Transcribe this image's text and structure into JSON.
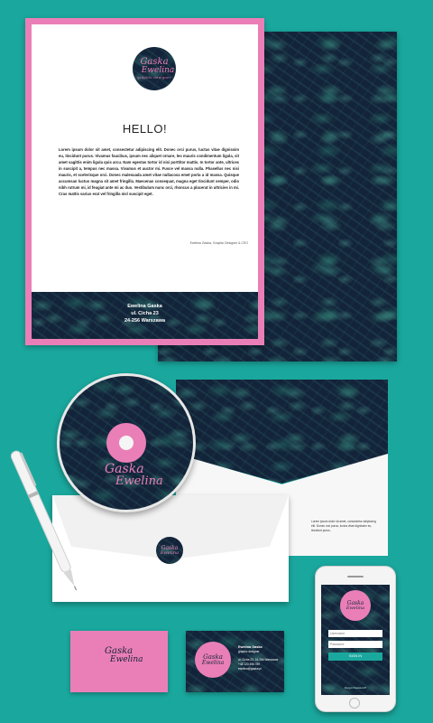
{
  "brand": {
    "logo_line1": "Gaska",
    "logo_line2": "Ewelina",
    "logo_tagline": "graphic designer",
    "accent": "#ea7fb7",
    "background": "#1aa89e",
    "dark": "#13243a"
  },
  "letterhead": {
    "heading": "HELLO!",
    "body": "Lorem ipsum dolor sit amet, consectetur adipiscing elit. Donec orci purus, luctus vitae dignissim eu, tincidunt purus. Vivamus faucibus, ipsum nec aliquet ornare, leo mauris condimentum ligula, sit amet sagittis enim ligula quis arcu. Nam egestas tortor id nisi porttitor mattis. In tortor ante, ultrices in suscipit a, tempus nec massa. Vivamus et auctor mi. Fusce vel massa nulla. Phasellus nec nisi mauris, et scelerisque orci. Donec malesuada amet vitae nullacosa emet porta a id massa. Quisque accumsan luctus magna sit amet fringilla. Maecenas consequat, magna eget tincidunt semper, odio nibh rutrum mi, id feugiat ante mi ac duo. Vestibulum nunc orci, rhoncus a placerat in ultricies in mi. Cras mattis varius erat vel fringilla nisl suscipit eget.",
    "signature": "Ewelina Gaska, Graphic Designer & CEO",
    "footer_name": "Ewelina Gaska",
    "footer_street": "ul. Cicha 23",
    "footer_city": "24-256 Warszawa"
  },
  "envelope_back": {
    "text": "Lorem ipsum dolor sit amet, consectetur adipiscing elit. Donec orci purus, luctus vitae dignissim eu, tincidunt purus."
  },
  "business_card": {
    "name": "Ewelina Gaska",
    "role": "graphic designer",
    "line1": "ul. Cicha 23, 24-256 Warszawa",
    "line2": "+48 123 456 789",
    "line3": "ewelina@gaska.pl"
  },
  "phone": {
    "username_placeholder": "Username",
    "password_placeholder": "Password",
    "signin_label": "SIGN IN",
    "forgot_label": "Forgot Password?"
  }
}
